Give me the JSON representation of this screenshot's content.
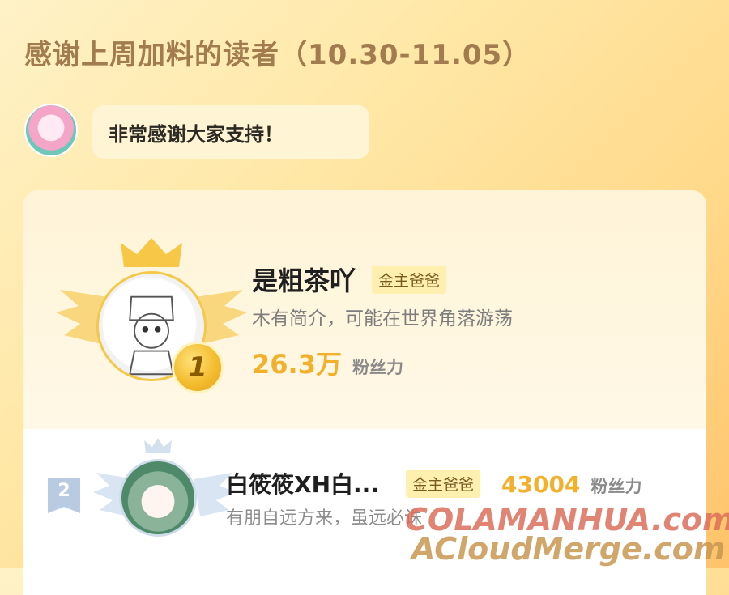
{
  "header": {
    "title": "感谢上周加料的读者（10.30-11.05）"
  },
  "message": {
    "text": "非常感谢大家支持！"
  },
  "rank1": {
    "rank": "1",
    "name": "是粗茶吖",
    "badge": "金主爸爸",
    "description": "木有简介，可能在世界角落游荡",
    "fans_value": "26.3万",
    "fans_label": "粉丝力"
  },
  "rank2": {
    "rank": "2",
    "name": "白筱筱XH白...",
    "badge": "金主爸爸",
    "description": "有朋自远方来，虽远必诛",
    "fans_value": "43004",
    "fans_label": "粉丝力"
  },
  "watermark": {
    "line1": "COLAMANHUA.com",
    "line2": "ACloudMerge.com"
  },
  "colors": {
    "gold": "#f2b12c",
    "title": "#a27b4f",
    "badge_bg": "#fff0b0"
  }
}
